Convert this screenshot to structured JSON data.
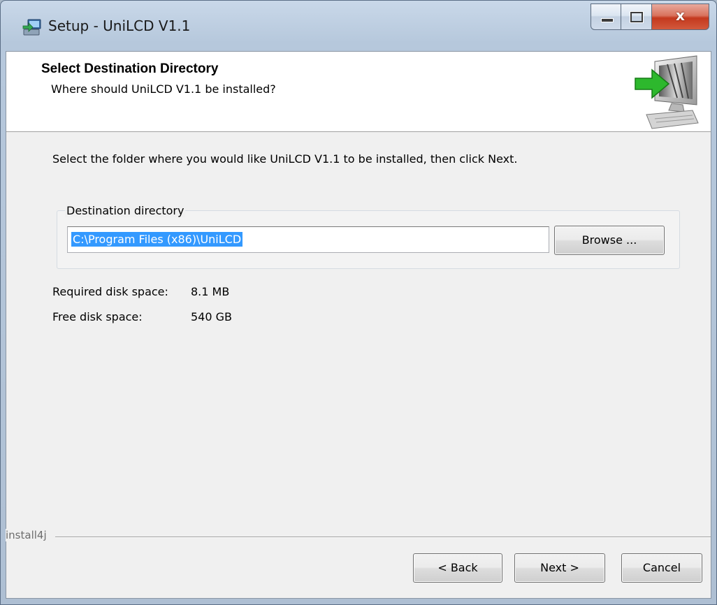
{
  "window": {
    "title": "Setup - UniLCD V1.1",
    "close_glyph": "x"
  },
  "header": {
    "title": "Select Destination Directory",
    "subtitle": "Where should UniLCD V1.1 be installed?"
  },
  "content": {
    "intro": "Select the folder where you would like UniLCD V1.1 to be installed, then click Next.",
    "group_label": "Destination directory",
    "path_value": "C:\\Program Files (x86)\\UniLCD",
    "browse_label": "Browse ...",
    "required_label": "Required disk space:",
    "required_value": "8.1 MB",
    "free_label": "Free disk space:",
    "free_value": "540 GB"
  },
  "footer": {
    "brand": "install4j",
    "back_label": "< Back",
    "next_label": "Next >",
    "cancel_label": "Cancel"
  },
  "icons": {
    "title_icon": "setup-computer-icon",
    "header_image": "computer-install-arrow-icon"
  },
  "colors": {
    "selection": "#3399ff",
    "close_button": "#c4391e",
    "arrow": "#2db82d"
  }
}
